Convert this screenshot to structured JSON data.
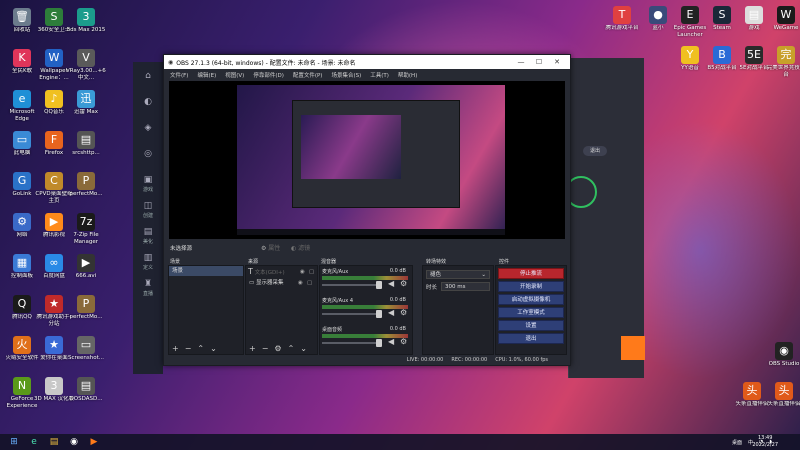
{
  "desktop_icons": [
    {
      "label": "回收站",
      "glyph": "🗑",
      "color": "#6b7b8c"
    },
    {
      "label": "360安全卫士",
      "glyph": "S",
      "color": "#2d7d3a"
    },
    {
      "label": "3ds Max 2015",
      "glyph": "3",
      "color": "#1b9c8c"
    },
    {
      "label": "全民K歌",
      "glyph": "K",
      "color": "#e0355a"
    },
    {
      "label": "Wallpaper Engine：...",
      "glyph": "W",
      "color": "#2261c4"
    },
    {
      "label": "VRay3.00...+64 中文...",
      "glyph": "V",
      "color": "#5a5a5a"
    },
    {
      "label": "Microsoft Edge",
      "glyph": "e",
      "color": "#1f8fd6"
    },
    {
      "label": "QQ音乐",
      "glyph": "♪",
      "color": "#f0c020"
    },
    {
      "label": "迅雷 Max",
      "glyph": "迅",
      "color": "#3a9ad6"
    },
    {
      "label": "此电脑",
      "glyph": "▭",
      "color": "#3a8ad6"
    },
    {
      "label": "Firefox",
      "glyph": "F",
      "color": "#e8641e"
    },
    {
      "label": "srcshttp...",
      "glyph": "▤",
      "color": "#555"
    },
    {
      "label": "GoLink",
      "glyph": "G",
      "color": "#2a72c8"
    },
    {
      "label": "CPVD桌面壁纸主页",
      "glyph": "C",
      "color": "#c08a2a"
    },
    {
      "label": "perfectMo...",
      "glyph": "P",
      "color": "#8a6a3a"
    },
    {
      "label": "网络",
      "glyph": "⚙",
      "color": "#3a6ac8"
    },
    {
      "label": "腾讯影视",
      "glyph": "▶",
      "color": "#ff8a1a"
    },
    {
      "label": "7-Zip File Manager",
      "glyph": "7z",
      "color": "#1a1a1a"
    },
    {
      "label": "控制面板",
      "glyph": "▦",
      "color": "#3a7ad6"
    },
    {
      "label": "百度网盘",
      "glyph": "∞",
      "color": "#2a8ae6"
    },
    {
      "label": "666.avi",
      "glyph": "▶",
      "color": "#333"
    },
    {
      "label": "腾讯QQ",
      "glyph": "Q",
      "color": "#1a1a1a"
    },
    {
      "label": "腾讯游戏助手-分站",
      "glyph": "★",
      "color": "#c02a2a"
    },
    {
      "label": "perfectMo...",
      "glyph": "P",
      "color": "#8a6a3a"
    },
    {
      "label": "火绒安全软件",
      "glyph": "火",
      "color": "#e0701a"
    },
    {
      "label": "爱你在桌面",
      "glyph": "★",
      "color": "#3a6ad6"
    },
    {
      "label": "Screenshot...",
      "glyph": "▭",
      "color": "#666"
    },
    {
      "label": "GeForce Experience",
      "glyph": "N",
      "color": "#5a9a1a"
    },
    {
      "label": "3D MAX 汉化版",
      "glyph": "3",
      "color": "#c8c8c8"
    },
    {
      "label": "DOSDASD...",
      "glyph": "▤",
      "color": "#555"
    }
  ],
  "right_icons": [
    {
      "label": "腾讯游戏平台",
      "glyph": "T",
      "color": "#e04040"
    },
    {
      "label": "蓝小",
      "glyph": "●",
      "color": "#3a4a7a"
    },
    {
      "label": "Epic Games Launcher",
      "glyph": "E",
      "color": "#222"
    },
    {
      "label": "Steam",
      "glyph": "S",
      "color": "#1b2838"
    },
    {
      "label": "游戏",
      "glyph": "▤",
      "color": "#ddd"
    },
    {
      "label": "WeGame",
      "glyph": "W",
      "color": "#1a1a1a"
    },
    {
      "label": "YY语音",
      "glyph": "Y",
      "color": "#f0c020"
    },
    {
      "label": "B5对战平台",
      "glyph": "B",
      "color": "#2a6ad6"
    },
    {
      "label": "5E对战平台",
      "glyph": "5E",
      "color": "#2a2a2a"
    },
    {
      "label": "完美世界竞技平台",
      "glyph": "完",
      "color": "#c8a02a"
    },
    {
      "label": "OBS Studio",
      "glyph": "◉",
      "color": "#222"
    },
    {
      "label": "头条直播伴侣",
      "glyph": "头",
      "color": "#e05a1a"
    },
    {
      "label": "头条直播伴侣",
      "glyph": "头",
      "color": "#e05a1a"
    }
  ],
  "obs": {
    "title": "OBS 27.1.3 (64-bit, windows) - 配置文件: 未命名 - 场景: 未命名",
    "menu": [
      "文件(F)",
      "编辑(E)",
      "视图(V)",
      "停靠部件(D)",
      "配置文件(P)",
      "场景集合(S)",
      "工具(T)",
      "帮助(H)"
    ],
    "no_source_selected": "未选择源",
    "dock_titles": {
      "scenes": "场景",
      "sources": "来源",
      "mixer": "混音器",
      "transitions": "转场特效",
      "controls": "控件"
    },
    "scenes": [
      "场景"
    ],
    "sources": [
      "显示器采集"
    ],
    "mixer": [
      {
        "name": "麦克风/Aux",
        "db": "0.0 dB"
      },
      {
        "name": "麦克风/Aux 4",
        "db": "0.0 dB"
      },
      {
        "name": "桌面音频",
        "db": "0.0 dB"
      }
    ],
    "transition": {
      "type": "褪色",
      "duration_label": "时长",
      "duration": "300 ms"
    },
    "controls": [
      "停止推流",
      "开始录制",
      "启动虚拟摄像机",
      "工作室模式",
      "设置",
      "退出"
    ],
    "status": {
      "live": "LIVE: 00:00:00",
      "rec": "REC: 00:00:00",
      "cpu": "CPU: 1.0%, 60.00 fps"
    }
  },
  "bg_app": {
    "side_items": [
      "",
      "",
      "",
      "",
      "游戏",
      "创建",
      "美化",
      "定义",
      "直播"
    ],
    "button": "退出",
    "live_tag": "ddd"
  },
  "taskbar": {
    "ime": "中",
    "time": "13:49",
    "date": "2022/2/27",
    "tray_label": "桌面"
  }
}
